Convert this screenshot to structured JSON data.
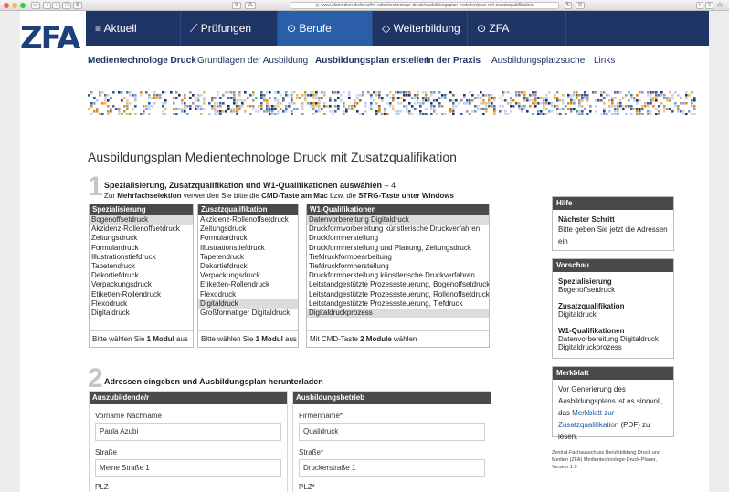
{
  "browser": {
    "url": "◎ www.zfamedien.de/beruf/m-edientechnologe-druck/ausbildungsplan-erstellen/plan-mit-zusatzqualifikation/"
  },
  "logo": "ZFA",
  "topnav": [
    {
      "label": "≡ Aktuell"
    },
    {
      "label": "⟋ Prüfungen"
    },
    {
      "label": "⊙ Berufe"
    },
    {
      "label": "◇ Weiterbildung"
    },
    {
      "label": "⊙ ZFA"
    }
  ],
  "subnav": [
    {
      "label": "Medientechnologe Druck"
    },
    {
      "label": "Grundlagen der Ausbildung"
    },
    {
      "label": "Ausbildungsplan erstellen"
    },
    {
      "label": "In der Praxis"
    },
    {
      "label": "Ausbildungsplatzsuche"
    },
    {
      "label": "Links"
    }
  ],
  "page_title": "Ausbildungsplan Medientechnologe Druck mit Zusatzqualifikation",
  "step1": {
    "num": "1",
    "heading": "Spezialisierung, Zusatzqualifikation und W1-Qualifikationen auswählen",
    "heading_suffix": "– 4",
    "sub_pre": "Zur ",
    "sub_b1": "Mehrfachselektion",
    "sub_mid": " verwenden Sie bitte die ",
    "sub_b2": "CMD-Taste am Mac",
    "sub_mid2": " bzw. die ",
    "sub_b3": "STRG-Taste unter Windows"
  },
  "lists": {
    "spezialisierung": {
      "header": "Spezialisierung",
      "options": [
        "Bogenoffsetdruck",
        "Akzidenz-Rollenoffsetdruck",
        "Zeitungsdruck",
        "Formulardruck",
        "Illustrationstiefdruck",
        "Tapetendruck",
        "Dekortiefdruck",
        "Verpackungsdruck",
        "Etiketten-Rollendruck",
        "Flexodruck",
        "Digitaldruck"
      ],
      "selected": [
        0
      ],
      "footer_pre": "Bitte wählen Sie ",
      "footer_b": "1 Modul",
      "footer_post": " aus"
    },
    "zusatz": {
      "header": "Zusatzqualifikation",
      "options": [
        "Akzidenz-Rollenoffsetdruck",
        "Zeitungsdruck",
        "Formulardruck",
        "Illustrationstiefdruck",
        "Tapetendruck",
        "Dekortiefdruck",
        "Verpackungsdruck",
        "Etiketten-Rollendruck",
        "Flexodruck",
        "Digitaldruck",
        "Großformatiger Digitaldruck"
      ],
      "selected": [
        9
      ],
      "footer_pre": "Bitte wählen Sie ",
      "footer_b": "1 Modul",
      "footer_post": " aus"
    },
    "w1": {
      "header": "W1-Qualifikationen",
      "options": [
        "Datenvorbereitung Digitaldruck",
        "Druckformvorbereitung künstlerische Druckverfahren",
        "Druckformherstellung",
        "Druckformherstellung und Planung, Zeitungsdruck",
        "Tiefdruckformbearbeitung",
        "Tiefdruckformherstellung",
        "Druckformherstellung künstlerische Druckverfahren",
        "Leitstandgestützte Prozesssteuerung, Bogenoffsetdruck",
        "Leitstandgestützte Prozesssteuerung, Rollenoffsetdruck",
        "Leitstandgestützte Prozesssteuerung, Tiefdruck",
        "Digitaldruckprozess"
      ],
      "selected": [
        0,
        10
      ],
      "footer_pre": "Mit CMD-Taste ",
      "footer_b": "2 Module",
      "footer_post": " wählen"
    }
  },
  "sidebar": {
    "hilfe": {
      "header": "Hilfe",
      "title": "Nächster Schritt",
      "text": "Bitte geben Sie jetzt die Adressen ein"
    },
    "vorschau": {
      "header": "Vorschau",
      "items": [
        {
          "label": "Spezialisierung",
          "value": "Bogenoffsetdruck"
        },
        {
          "label": "Zusatzqualifikation",
          "value": "Digitaldruck"
        },
        {
          "label": "W1-Qualifikationen",
          "value": "Datenvorbereitung Digitaldruck\nDigitaldruckprozess"
        }
      ]
    },
    "merkblatt": {
      "header": "Merkblatt",
      "text_pre": "Vor Generierung des Ausbildungsplans ist es sinnvoll, das ",
      "link": "Merkblatt zur Zusatzqualifikation",
      "text_post": " (PDF) zu lesen."
    },
    "fineprint": "Zentral-Fachausschuss Berufsbildung Druck und Medien (ZFA) Medientechnologe-Druck-Planer, Version 1.0"
  },
  "step2": {
    "num": "2",
    "heading": "Adressen eingeben und Ausbildungsplan herunterladen"
  },
  "azubi": {
    "header": "Auszubildende/r",
    "name_label": "Vorname Nachname",
    "name_value": "Paula Azubi",
    "street_label": "Straße",
    "street_value": "Meine Straße 1",
    "plz_label": "PLZ"
  },
  "betrieb": {
    "header": "Ausbildungsbetrieb",
    "firm_label": "Firmenname*",
    "firm_value": "Qualidruck",
    "street_label": "Straße*",
    "street_value": "Druckerstraße 1",
    "plz_label": "PLZ*"
  },
  "colors": {
    "nav": "#1e3565",
    "nav_active": "#2a5ea9",
    "accent": "#e88b00",
    "box_header": "#4a4a4a"
  }
}
